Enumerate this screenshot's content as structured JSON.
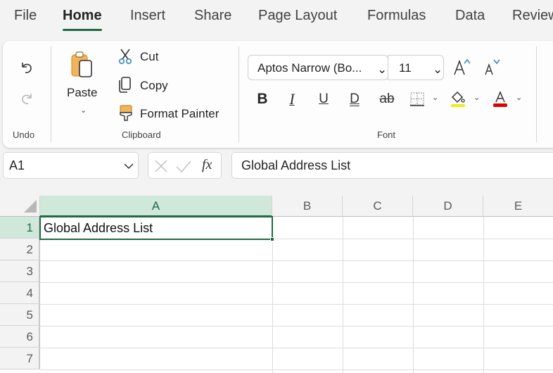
{
  "tabs": [
    {
      "label": "File"
    },
    {
      "label": "Home",
      "active": true
    },
    {
      "label": "Insert"
    },
    {
      "label": "Share"
    },
    {
      "label": "Page Layout"
    },
    {
      "label": "Formulas"
    },
    {
      "label": "Data"
    },
    {
      "label": "Review"
    }
  ],
  "ribbon": {
    "undo_group": {
      "label": "Undo",
      "undo_icon": "undo-icon",
      "redo_icon": "redo-icon"
    },
    "clipboard_group": {
      "label": "Clipboard",
      "paste": "Paste",
      "cut": "Cut",
      "copy": "Copy",
      "format_painter": "Format Painter"
    },
    "font_group": {
      "label": "Font",
      "font_name": "Aptos Narrow (Bo...",
      "font_size": "11",
      "bold": "B",
      "italic": "I",
      "underline": "U",
      "double_underline": "D",
      "strikethrough": "ab",
      "fill_color": "#f5ea14",
      "font_color": "#e00000"
    }
  },
  "formula_bar": {
    "name_box": "A1",
    "fx": "fx",
    "value": "Global Address List"
  },
  "grid": {
    "columns": [
      "A",
      "B",
      "C",
      "D",
      "E"
    ],
    "rows": [
      "1",
      "2",
      "3",
      "4",
      "5",
      "6",
      "7"
    ],
    "selected_cell": "A1",
    "cells": {
      "A1": "Global Address List"
    }
  },
  "colors": {
    "accent": "#1e6b43",
    "selected_header": "#cfe8da"
  }
}
